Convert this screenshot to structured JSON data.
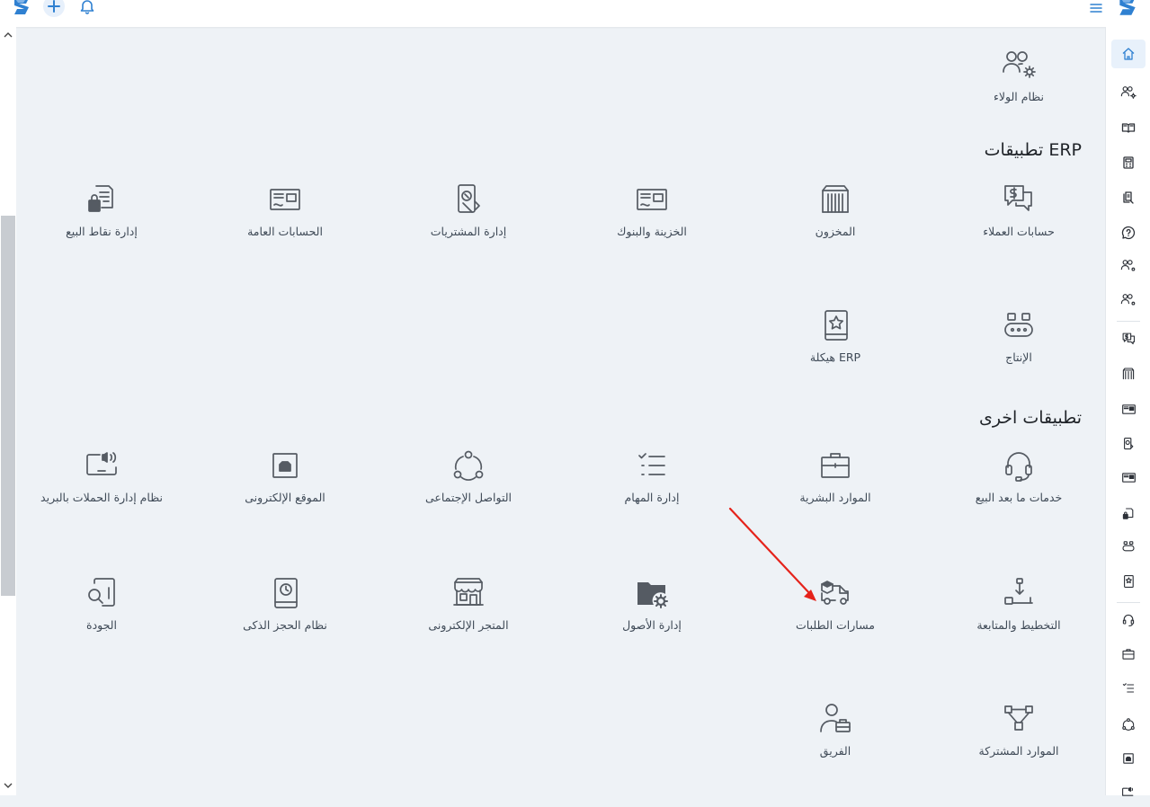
{
  "colors": {
    "accent": "#2f80d1",
    "arrow": "#e5231b",
    "background": "#eef2f6"
  },
  "sections": {
    "erp_title": "تطبيقات ERP",
    "other_title": "تطبيقات اخرى"
  },
  "apps": {
    "loyalty": "نظام الولاء",
    "customers": "حسابات العملاء",
    "inventory": "المخزون",
    "treasury": "الخزينة والبنوك",
    "purchases": "إدارة المشتريات",
    "accounts": "الحسابات العامة",
    "pos": "إدارة نقاط البيع",
    "manufacturing": "الإنتاج",
    "erp_structure": "هيكلة ERP",
    "after_sales": "خدمات ما بعد البيع",
    "hr": "الموارد البشرية",
    "tasks": "إدارة المهام",
    "social": "التواصل الإجتماعى",
    "website": "الموقع الإلكترونى",
    "email_campaigns": "نظام إدارة الحملات بالبريد",
    "planning": "التخطيط والمتابعة",
    "order_routes": "مسارات الطلبات",
    "assets": "إدارة الأصول",
    "ecommerce": "المتجر الإلكترونى",
    "booking": "نظام الحجز الذكى",
    "quality": "الجودة",
    "shared_resources": "الموارد المشتركة",
    "team": "الفريق"
  },
  "sidebar_icons": [
    "home-icon",
    "users-gear-icon",
    "book-icon",
    "calculator-icon",
    "document-stack-icon",
    "question-icon",
    "users-icon",
    "users-icon",
    "money-chat-icon",
    "warehouse-icon",
    "card-icon",
    "hand-money-icon",
    "card-icon",
    "lock-doc-icon",
    "robot-icon",
    "star-book-icon",
    "headset-icon",
    "briefcase-icon",
    "task-list-icon",
    "network-icon",
    "website-icon",
    "megaphone-icon"
  ]
}
